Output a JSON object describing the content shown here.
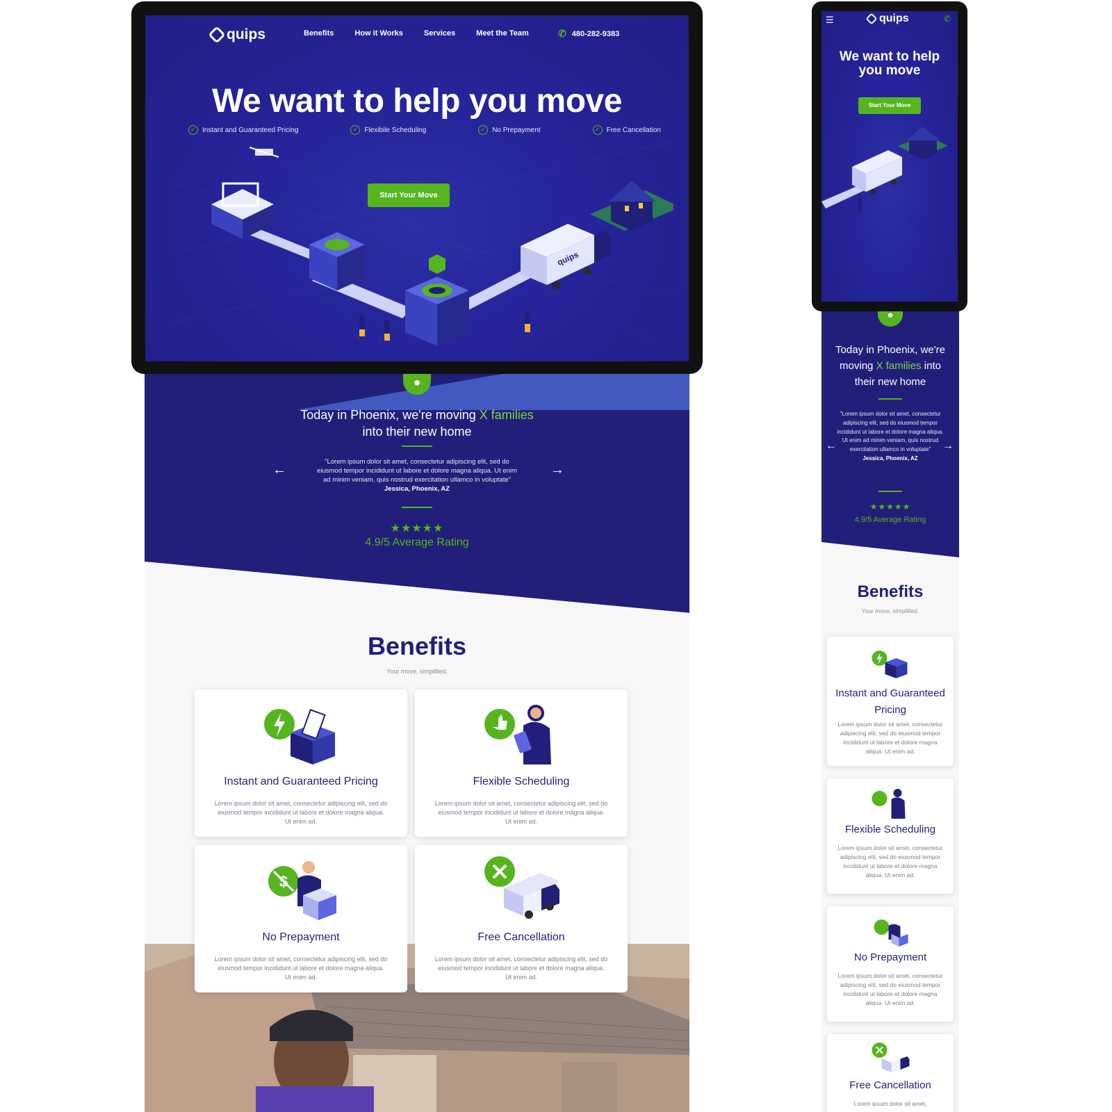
{
  "brand": {
    "name": "quips",
    "colors": {
      "navy": "#221f7a",
      "hero_blue": "#25249a",
      "green": "#56b51e",
      "light_green": "#7fd63b",
      "bg": "#f7f7f8"
    }
  },
  "nav": {
    "items": [
      "Benefits",
      "How it Works",
      "Services",
      "Meet the Team"
    ],
    "phone": "480-282-9383",
    "phone_icon": "phone-icon",
    "menu_icon": "hamburger-menu-icon"
  },
  "hero": {
    "title": "We want to help you move",
    "features": [
      "Instant and Guaranteed Pricing",
      "Flexibile Scheduling",
      "No Prepayment",
      "Free Cancellation"
    ],
    "cta": "Start Your Move"
  },
  "testimonial": {
    "headline_pre": "Today in Phoenix, we're moving",
    "headline_highlight": "X families",
    "headline_post": "into their new home",
    "quote": "\"Lorem ipsum dolor sit amet, consectetur adipiscing elit, sed do eiusmod tempor incididunt ut labore et dolore magna aliqua. Ut enim ad minim veniam, quis nostrud exercitation ullamco in voluptate\"",
    "author": "Jessica, Phoenix, AZ",
    "stars": "★★★★★",
    "rating_text": "4.9/5 Average Rating"
  },
  "benefits": {
    "title": "Benefits",
    "subtitle": "Your move, simplified.",
    "cards": [
      {
        "title": "Instant and Guaranteed Pricing",
        "icon": "lightning-box-icon",
        "text": "Lorem ipsum dolor sit amet, consectetur adipiscing elit, sed do eiusmod tempor incididunt ut labore et dolore magna aliqua. Ut enim ad."
      },
      {
        "title": "Flexible Scheduling",
        "icon": "thumbs-up-icon",
        "text": "Lorem ipsum dolor sit amet, consectetur adipiscing elit, sed do eiusmod tempor incididunt ut labore et dolore magna aliqua. Ut enim ad."
      },
      {
        "title": "No Prepayment",
        "icon": "no-dollar-icon",
        "text": "Lorem ipsum dolor sit amet, consectetur adipiscing elit, sed do eiusmod tempor incididunt ut labore et dolore magna aliqua. Ut enim ad."
      },
      {
        "title": "Free Cancellation",
        "icon": "cancel-truck-icon",
        "text": "Lorem ipsum dolor sit amet, consectetur adipiscing elit, sed do eiusmod tempor incididunt ut labore et dolore magna aliqua. Ut enim ad."
      }
    ]
  },
  "mobile_last_card_text": "Lorem ipsum dolor sit amet,"
}
